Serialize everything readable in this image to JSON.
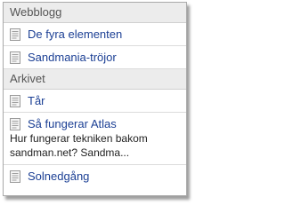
{
  "sections": [
    {
      "title": "Webblogg",
      "items": [
        {
          "label": "De fyra elementen",
          "icon": "document-icon"
        },
        {
          "label": "Sandmania-tröjor",
          "icon": "document-icon"
        }
      ]
    },
    {
      "title": "Arkivet",
      "items": [
        {
          "label": "Tår",
          "icon": "document-icon"
        },
        {
          "label": "Så fungerar Atlas",
          "icon": "document-icon",
          "excerpt": "Hur fungerar tekniken bakom sandman.net? Sandma..."
        },
        {
          "label": "Solnedgång",
          "icon": "document-icon"
        }
      ]
    }
  ],
  "colors": {
    "link": "#1b3f94",
    "header_bg": "#ececec",
    "header_text": "#555555",
    "border": "#a9a9a9"
  }
}
